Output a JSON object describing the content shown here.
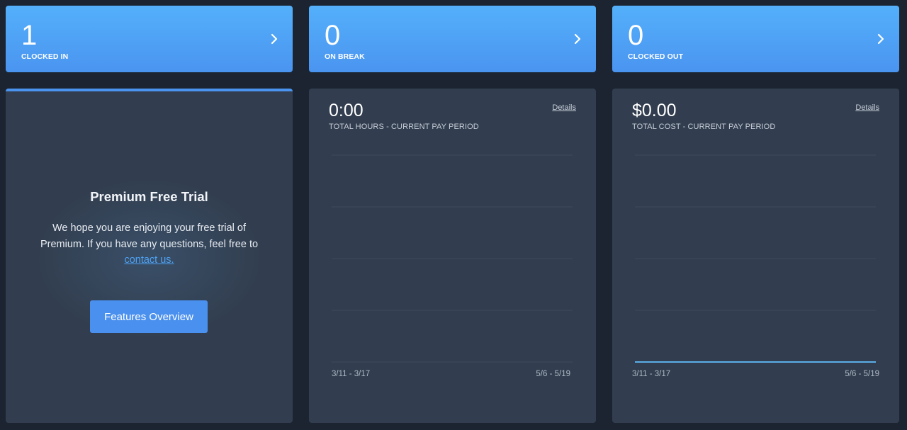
{
  "stats": [
    {
      "count": "1",
      "label": "CLOCKED IN"
    },
    {
      "count": "0",
      "label": "ON BREAK"
    },
    {
      "count": "0",
      "label": "CLOCKED OUT"
    }
  ],
  "promo": {
    "title": "Premium Free Trial",
    "text": "We hope you are enjoying your free trial of Premium. If you have any questions, feel free to",
    "link": "contact us.",
    "button": "Features Overview"
  },
  "hours": {
    "value": "0:00",
    "label": "TOTAL HOURS - CURRENT PAY PERIOD",
    "details": "Details"
  },
  "cost": {
    "value": "$0.00",
    "label": "TOTAL COST - CURRENT PAY PERIOD",
    "details": "Details"
  },
  "chart_data": [
    {
      "type": "line",
      "x_tick_labels": [
        "3/11 - 3/17",
        "5/6 - 5/19"
      ],
      "series": [],
      "grid": true
    },
    {
      "type": "line",
      "x_tick_labels": [
        "3/11 - 3/17",
        "5/6 - 5/19"
      ],
      "series": [
        {
          "values": [
            0,
            0
          ]
        }
      ],
      "grid": true,
      "line_color": "#5aaee6"
    }
  ],
  "colors": {
    "accent": "#4a94f0",
    "card": "#323e4f",
    "background": "#1b2430"
  }
}
